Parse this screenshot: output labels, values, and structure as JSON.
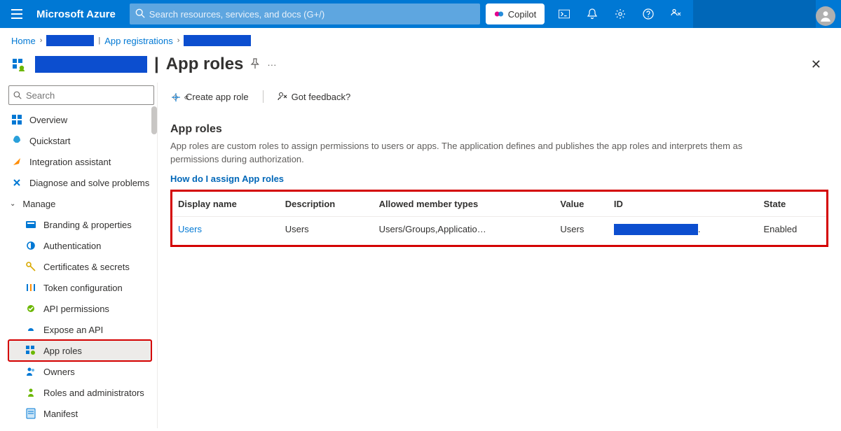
{
  "header": {
    "brand": "Microsoft Azure",
    "search_placeholder": "Search resources, services, and docs (G+/)",
    "copilot_label": "Copilot"
  },
  "breadcrumbs": {
    "home": "Home",
    "app_registrations": "App registrations"
  },
  "page_title": {
    "separator": "|",
    "title": "App roles"
  },
  "sidebar": {
    "search_placeholder": "Search",
    "items": [
      {
        "label": "Overview"
      },
      {
        "label": "Quickstart"
      },
      {
        "label": "Integration assistant"
      },
      {
        "label": "Diagnose and solve problems"
      },
      {
        "label": "Manage",
        "group": true
      },
      {
        "label": "Branding & properties",
        "sub": true
      },
      {
        "label": "Authentication",
        "sub": true
      },
      {
        "label": "Certificates & secrets",
        "sub": true
      },
      {
        "label": "Token configuration",
        "sub": true
      },
      {
        "label": "API permissions",
        "sub": true
      },
      {
        "label": "Expose an API",
        "sub": true
      },
      {
        "label": "App roles",
        "sub": true,
        "selected": true
      },
      {
        "label": "Owners",
        "sub": true
      },
      {
        "label": "Roles and administrators",
        "sub": true
      },
      {
        "label": "Manifest",
        "sub": true
      }
    ]
  },
  "cmdbar": {
    "create": "Create app role",
    "feedback": "Got feedback?"
  },
  "content": {
    "section_title": "App roles",
    "description": "App roles are custom roles to assign permissions to users or apps. The application defines and publishes the app roles and interprets them as permissions during authorization.",
    "help_link": "How do I assign App roles",
    "columns": {
      "display_name": "Display name",
      "description": "Description",
      "allowed": "Allowed member types",
      "value": "Value",
      "id": "ID",
      "state": "State"
    },
    "rows": [
      {
        "display_name": "Users",
        "description": "Users",
        "allowed": "Users/Groups,Applicatio…",
        "value": "Users",
        "state": "Enabled"
      }
    ]
  }
}
